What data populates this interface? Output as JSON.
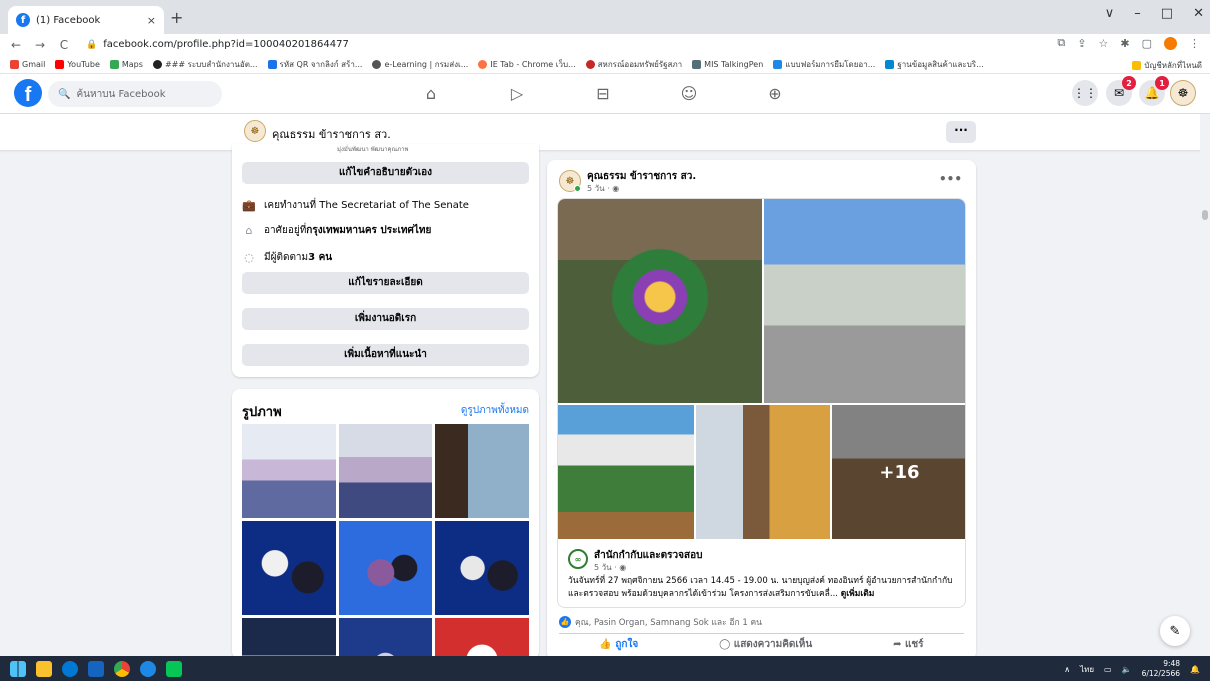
{
  "browser": {
    "tab_title": "(1) Facebook",
    "tab_close": "×",
    "new_tab": "+",
    "url": "facebook.com/profile.php?id=100040201864477",
    "window_controls": [
      "∨",
      "–",
      "□",
      "✕"
    ],
    "bookmarks": [
      {
        "label": "Gmail",
        "color": "#ea4335"
      },
      {
        "label": "YouTube",
        "color": "#ff0000"
      },
      {
        "label": "Maps",
        "color": "#34a853"
      },
      {
        "label": "### ระบบสำนักงานอัต...",
        "color": "#202124"
      },
      {
        "label": "รหัส QR จากลิงก์ สร้า...",
        "color": "#1a73e8"
      },
      {
        "label": "e-Learning | กรมส่งเ...",
        "color": "#555555"
      },
      {
        "label": "IE Tab - Chrome เว็บ...",
        "color": "#ff7043"
      },
      {
        "label": "สหกรณ์ออมทรัพย์รัฐสภา",
        "color": "#c62828"
      },
      {
        "label": "MIS TalkingPen",
        "color": "#546e7a"
      },
      {
        "label": "แบบฟอร์มการยืมโดยอา...",
        "color": "#1e88e5"
      },
      {
        "label": "ฐานข้อมูลสินค้าและบริ...",
        "color": "#0288d1"
      }
    ],
    "bookmark_right": "บัญชีหลักที่ไหนดี"
  },
  "fb_header": {
    "logo": "f",
    "search_placeholder": "ค้นหาบน Facebook",
    "messenger_badge": "2",
    "notif_badge": "1"
  },
  "profile": {
    "name": "คุณธรรม ข้าราชการ สว."
  },
  "intro": {
    "cutoff_text": "มุ่งมั่นพัฒนา พัฒนาคุณภาพ",
    "edit_bio": "แก้ไขคำอธิบายตัวเอง",
    "work_prefix": "เคยทำงานที่ ",
    "work_place": "The Secretariat of The Senate",
    "lives_prefix": "อาศัยอยู่ที่ ",
    "lives_place": "กรุงเทพมหานคร ประเทศไทย",
    "followers_prefix": "มีผู้ติดตาม ",
    "followers_count": "3 คน",
    "edit_details": "แก้ไขรายละเอียด",
    "add_hobbies": "เพิ่มงานอดิเรก",
    "add_featured": "เพิ่มเนื้อหาที่แนะนำ"
  },
  "photos": {
    "heading": "รูปภาพ",
    "see_all": "ดูรูปภาพทั้งหมด",
    "colors": {
      "blue_poster": "#0c2d83",
      "accent": "#2d6cdf"
    }
  },
  "post": {
    "author": "คุณธรรม ข้าราชการ สว.",
    "time": "5 วัน · ",
    "more": "•••",
    "extra_photos": "+16",
    "shared_author": "สำนักกำกับและตรวจสอบ",
    "shared_avatar": "∞",
    "shared_time": "5 วัน · ",
    "shared_text": "วันจันทร์ที่ 27 พฤศจิกายน 2566 เวลา 14.45 - 19.00 น. นายบุญส่งค์ ทองอินทร์ ผู้อำนวยการสำนักกำกับและตรวจสอบ พร้อมด้วยบุคลากรได้เข้าร่วม โครงการส่งเสริมการขับเคลื่... ",
    "see_more": "ดูเพิ่มเติม",
    "reactions": "คุณ, Pasin Organ, Samnang Sok และ อีก 1 คน",
    "action_like": "ถูกใจ",
    "action_comment": "แสดงความคิดเห็น",
    "action_share": "แชร์"
  },
  "taskbar": {
    "lang": "ไทย",
    "time": "9:48",
    "date": "6/12/2566"
  }
}
